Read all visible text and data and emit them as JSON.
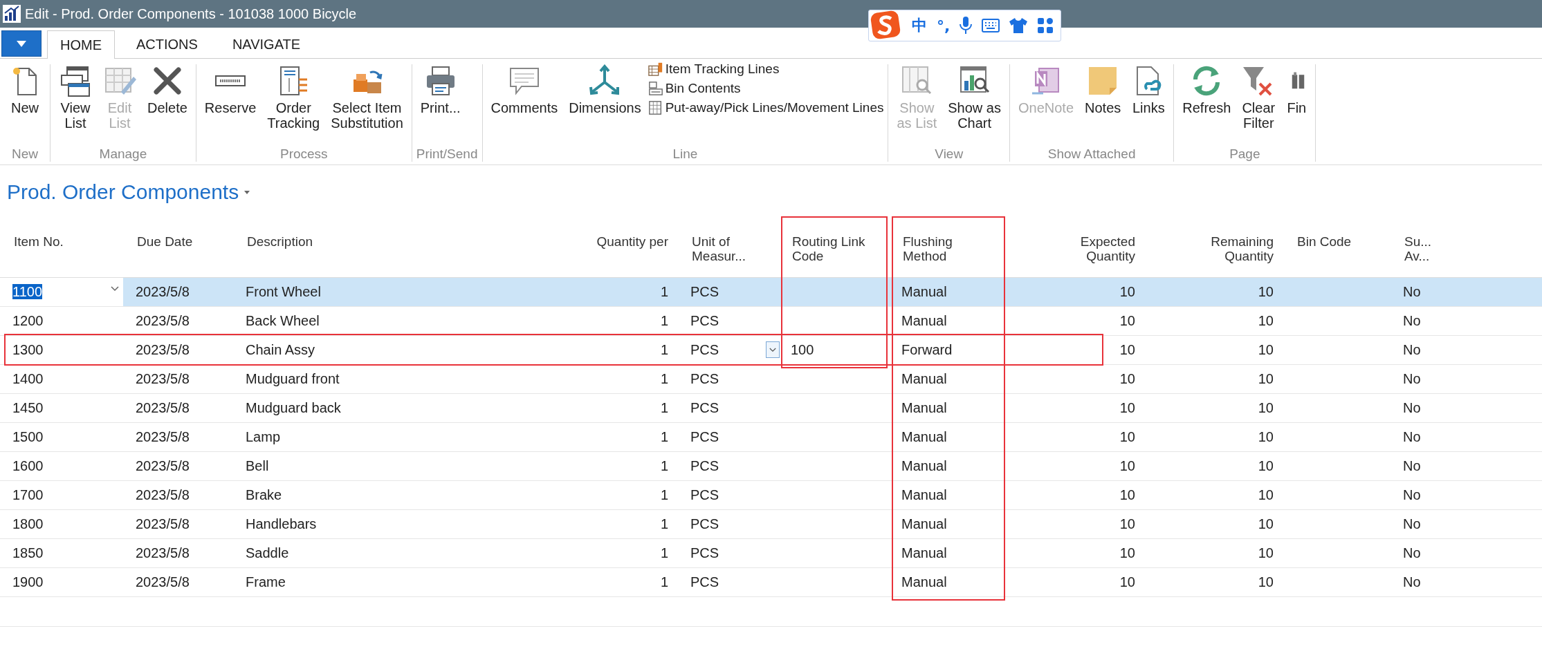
{
  "window": {
    "title": "Edit - Prod. Order Components - 101038 1000 Bicycle"
  },
  "ime_toolbar": {
    "mode": "中",
    "punctuation": "°,"
  },
  "tabs": [
    {
      "label": "HOME",
      "selected": true
    },
    {
      "label": "ACTIONS",
      "selected": false
    },
    {
      "label": "NAVIGATE",
      "selected": false
    }
  ],
  "ribbon": [
    {
      "label": "New",
      "items": [
        {
          "kind": "new",
          "label": "New",
          "disabled": false
        }
      ]
    },
    {
      "label": "Manage",
      "items": [
        {
          "kind": "view-list",
          "label": "View\nList",
          "disabled": false
        },
        {
          "kind": "edit-list",
          "label": "Edit\nList",
          "disabled": true
        },
        {
          "kind": "delete",
          "label": "Delete",
          "disabled": false
        }
      ]
    },
    {
      "label": "Process",
      "items": [
        {
          "kind": "reserve",
          "label": "Reserve",
          "disabled": false
        },
        {
          "kind": "order-tracking",
          "label": "Order\nTracking",
          "disabled": false
        },
        {
          "kind": "substitution",
          "label": "Select Item\nSubstitution",
          "disabled": false
        }
      ]
    },
    {
      "label": "Print/Send",
      "items": [
        {
          "kind": "print",
          "label": "Print...",
          "disabled": false
        }
      ]
    },
    {
      "label": "Line",
      "items": [
        {
          "kind": "comments",
          "label": "Comments",
          "disabled": false
        },
        {
          "kind": "dimensions",
          "label": "Dimensions",
          "disabled": false
        }
      ],
      "small_items": [
        {
          "kind": "tracking-lines",
          "label": "Item Tracking Lines"
        },
        {
          "kind": "bin-contents",
          "label": "Bin Contents"
        },
        {
          "kind": "pick-lines",
          "label": "Put-away/Pick Lines/Movement Lines"
        }
      ]
    },
    {
      "label": "View",
      "items": [
        {
          "kind": "show-list",
          "label": "Show\nas List",
          "disabled": true
        },
        {
          "kind": "show-chart",
          "label": "Show as\nChart",
          "disabled": false
        }
      ]
    },
    {
      "label": "Show Attached",
      "items": [
        {
          "kind": "onenote",
          "label": "OneNote",
          "disabled": true
        },
        {
          "kind": "notes",
          "label": "Notes",
          "disabled": false
        },
        {
          "kind": "links",
          "label": "Links",
          "disabled": false
        }
      ]
    },
    {
      "label": "Page",
      "items": [
        {
          "kind": "refresh",
          "label": "Refresh",
          "disabled": false
        },
        {
          "kind": "clear-filter",
          "label": "Clear\nFilter",
          "disabled": false
        },
        {
          "kind": "find",
          "label": "Fin",
          "disabled": false
        }
      ]
    }
  ],
  "page_title": "Prod. Order Components",
  "table": {
    "columns": [
      {
        "label": "Item No.",
        "annotated": false
      },
      {
        "label": "Due Date",
        "annotated": false
      },
      {
        "label": "Description",
        "annotated": false
      },
      {
        "label": "Quantity per",
        "annotated": false
      },
      {
        "label": "Unit of\nMeasur...",
        "annotated": false
      },
      {
        "label": "Routing Link\nCode",
        "annotated": true
      },
      {
        "label": "Flushing\nMethod",
        "annotated": true
      },
      {
        "label": "Expected\nQuantity",
        "annotated": false
      },
      {
        "label": "Remaining\nQuantity",
        "annotated": false
      },
      {
        "label": "Bin Code",
        "annotated": false
      },
      {
        "label": "Su...\nAv...",
        "annotated": false
      }
    ],
    "rows": [
      {
        "selected": true,
        "editing": false,
        "item_no": "1100",
        "due_date": "2023/5/8",
        "description": "Front Wheel",
        "quantity_per": "1",
        "unit": "PCS",
        "flushing_method": "Manual",
        "expected_quantity": "10",
        "remaining_quantity": "10",
        "substitute": "No"
      },
      {
        "selected": false,
        "editing": false,
        "item_no": "1200",
        "due_date": "2023/5/8",
        "description": "Back Wheel",
        "quantity_per": "1",
        "unit": "PCS",
        "flushing_method": "Manual",
        "expected_quantity": "10",
        "remaining_quantity": "10",
        "substitute": "No"
      },
      {
        "selected": false,
        "editing": true,
        "annotated": true,
        "item_no": "1300",
        "due_date": "2023/5/8",
        "description": "Chain Assy",
        "quantity_per": "1",
        "unit": "PCS",
        "routing_link_code": "100",
        "flushing_method": "Forward",
        "expected_quantity": "10",
        "remaining_quantity": "10",
        "substitute": "No"
      },
      {
        "selected": false,
        "editing": false,
        "item_no": "1400",
        "due_date": "2023/5/8",
        "description": "Mudguard front",
        "quantity_per": "1",
        "unit": "PCS",
        "flushing_method": "Manual",
        "expected_quantity": "10",
        "remaining_quantity": "10",
        "substitute": "No"
      },
      {
        "selected": false,
        "editing": false,
        "item_no": "1450",
        "due_date": "2023/5/8",
        "description": "Mudguard back",
        "quantity_per": "1",
        "unit": "PCS",
        "flushing_method": "Manual",
        "expected_quantity": "10",
        "remaining_quantity": "10",
        "substitute": "No"
      },
      {
        "selected": false,
        "editing": false,
        "item_no": "1500",
        "due_date": "2023/5/8",
        "description": "Lamp",
        "quantity_per": "1",
        "unit": "PCS",
        "flushing_method": "Manual",
        "expected_quantity": "10",
        "remaining_quantity": "10",
        "substitute": "No"
      },
      {
        "selected": false,
        "editing": false,
        "item_no": "1600",
        "due_date": "2023/5/8",
        "description": "Bell",
        "quantity_per": "1",
        "unit": "PCS",
        "flushing_method": "Manual",
        "expected_quantity": "10",
        "remaining_quantity": "10",
        "substitute": "No"
      },
      {
        "selected": false,
        "editing": false,
        "item_no": "1700",
        "due_date": "2023/5/8",
        "description": "Brake",
        "quantity_per": "1",
        "unit": "PCS",
        "flushing_method": "Manual",
        "expected_quantity": "10",
        "remaining_quantity": "10",
        "substitute": "No"
      },
      {
        "selected": false,
        "editing": false,
        "item_no": "1800",
        "due_date": "2023/5/8",
        "description": "Handlebars",
        "quantity_per": "1",
        "unit": "PCS",
        "flushing_method": "Manual",
        "expected_quantity": "10",
        "remaining_quantity": "10",
        "substitute": "No"
      },
      {
        "selected": false,
        "editing": false,
        "item_no": "1850",
        "due_date": "2023/5/8",
        "description": "Saddle",
        "quantity_per": "1",
        "unit": "PCS",
        "flushing_method": "Manual",
        "expected_quantity": "10",
        "remaining_quantity": "10",
        "substitute": "No"
      },
      {
        "selected": false,
        "editing": false,
        "item_no": "1900",
        "due_date": "2023/5/8",
        "description": "Frame",
        "quantity_per": "1",
        "unit": "PCS",
        "flushing_method": "Manual",
        "expected_quantity": "10",
        "remaining_quantity": "10",
        "substitute": "No"
      }
    ]
  }
}
